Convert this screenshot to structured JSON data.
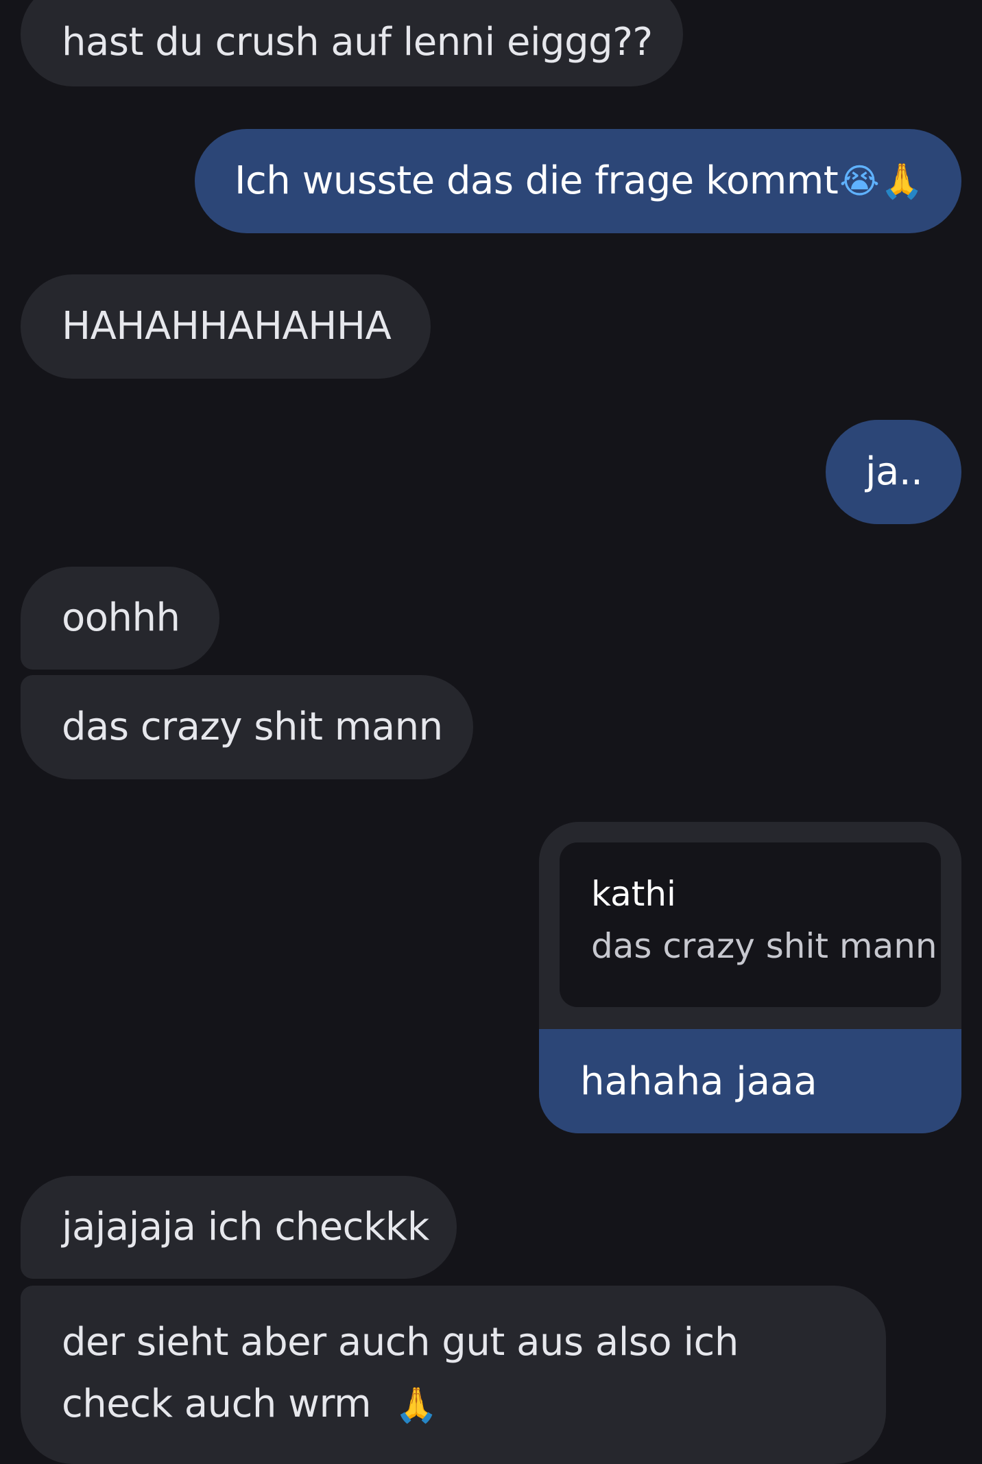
{
  "messages": [
    {
      "id": "m1",
      "direction": "incoming",
      "text": "hast du crush auf lenni eiggg??"
    },
    {
      "id": "m2",
      "direction": "outgoing",
      "text": "Ich wusste das die frage kommt",
      "emojis": [
        "😭",
        "🙏"
      ]
    },
    {
      "id": "m3",
      "direction": "incoming",
      "text": "HAHAHHAHAHHA"
    },
    {
      "id": "m4",
      "direction": "outgoing",
      "text": "ja.."
    },
    {
      "id": "m5",
      "direction": "incoming",
      "text": "oohhh"
    },
    {
      "id": "m6",
      "direction": "incoming",
      "text": "das crazy shit mann"
    },
    {
      "id": "m7",
      "direction": "outgoing",
      "reply_to": {
        "author": "kathi",
        "text": "das crazy shit mann"
      },
      "text": "hahaha jaaa"
    },
    {
      "id": "m8",
      "direction": "incoming",
      "text": "jajajaja ich checkkk"
    },
    {
      "id": "m9",
      "direction": "incoming",
      "lines": [
        "der sieht aber auch gut aus also ich",
        "check auch wrm"
      ],
      "emoji": "🙏"
    }
  ],
  "colors": {
    "background": "#141419",
    "incoming_bubble": "#26272d",
    "outgoing_bubble": "#2c4677",
    "text": "#e6e7ec"
  }
}
